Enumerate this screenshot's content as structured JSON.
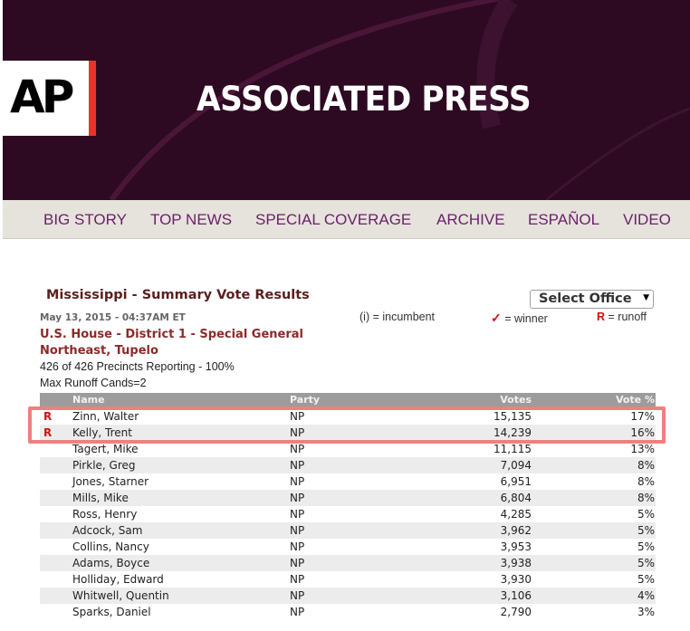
{
  "brand": {
    "logo_text": "AP",
    "name": "ASSOCIATED PRESS",
    "colors": {
      "banner": "#2e0a22",
      "logo_accent": "#e5342a",
      "nav_link": "#6b1e6b"
    }
  },
  "nav": {
    "items": [
      "BIG STORY",
      "TOP NEWS",
      "SPECIAL COVERAGE",
      "ARCHIVE",
      "ESPAÑOL",
      "VIDEO"
    ]
  },
  "results": {
    "title": "Mississippi - Summary Vote Results",
    "office_select": {
      "selected": "Select Office",
      "icon": "chevron-down-icon"
    },
    "timestamp": "May 13, 2015 - 04:37AM ET",
    "legend": {
      "incumbent": "(i) = incumbent",
      "winner_symbol": "✓",
      "winner": "= winner",
      "runoff_symbol": "R",
      "runoff": "= runoff"
    },
    "race": "U.S. House - District 1 - Special General",
    "region": "Northeast, Tupelo",
    "precincts": "426 of 426 Precincts Reporting - 100%",
    "max_runoff": "Max Runoff Cands=2",
    "columns": {
      "name": "Name",
      "party": "Party",
      "votes": "Votes",
      "pct": "Vote %"
    },
    "candidates": [
      {
        "mark": "R",
        "name": "Zinn, Walter",
        "party": "NP",
        "votes": "15,135",
        "pct": "17%"
      },
      {
        "mark": "R",
        "name": "Kelly, Trent",
        "party": "NP",
        "votes": "14,239",
        "pct": "16%"
      },
      {
        "mark": "",
        "name": "Tagert, Mike",
        "party": "NP",
        "votes": "11,115",
        "pct": "13%"
      },
      {
        "mark": "",
        "name": "Pirkle, Greg",
        "party": "NP",
        "votes": "7,094",
        "pct": "8%"
      },
      {
        "mark": "",
        "name": "Jones, Starner",
        "party": "NP",
        "votes": "6,951",
        "pct": "8%"
      },
      {
        "mark": "",
        "name": "Mills, Mike",
        "party": "NP",
        "votes": "6,804",
        "pct": "8%"
      },
      {
        "mark": "",
        "name": "Ross, Henry",
        "party": "NP",
        "votes": "4,285",
        "pct": "5%"
      },
      {
        "mark": "",
        "name": "Adcock, Sam",
        "party": "NP",
        "votes": "3,962",
        "pct": "5%"
      },
      {
        "mark": "",
        "name": "Collins, Nancy",
        "party": "NP",
        "votes": "3,953",
        "pct": "5%"
      },
      {
        "mark": "",
        "name": "Adams, Boyce",
        "party": "NP",
        "votes": "3,938",
        "pct": "5%"
      },
      {
        "mark": "",
        "name": "Holliday, Edward",
        "party": "NP",
        "votes": "3,930",
        "pct": "5%"
      },
      {
        "mark": "",
        "name": "Whitwell, Quentin",
        "party": "NP",
        "votes": "3,106",
        "pct": "4%"
      },
      {
        "mark": "",
        "name": "Sparks, Daniel",
        "party": "NP",
        "votes": "2,790",
        "pct": "3%"
      }
    ]
  }
}
